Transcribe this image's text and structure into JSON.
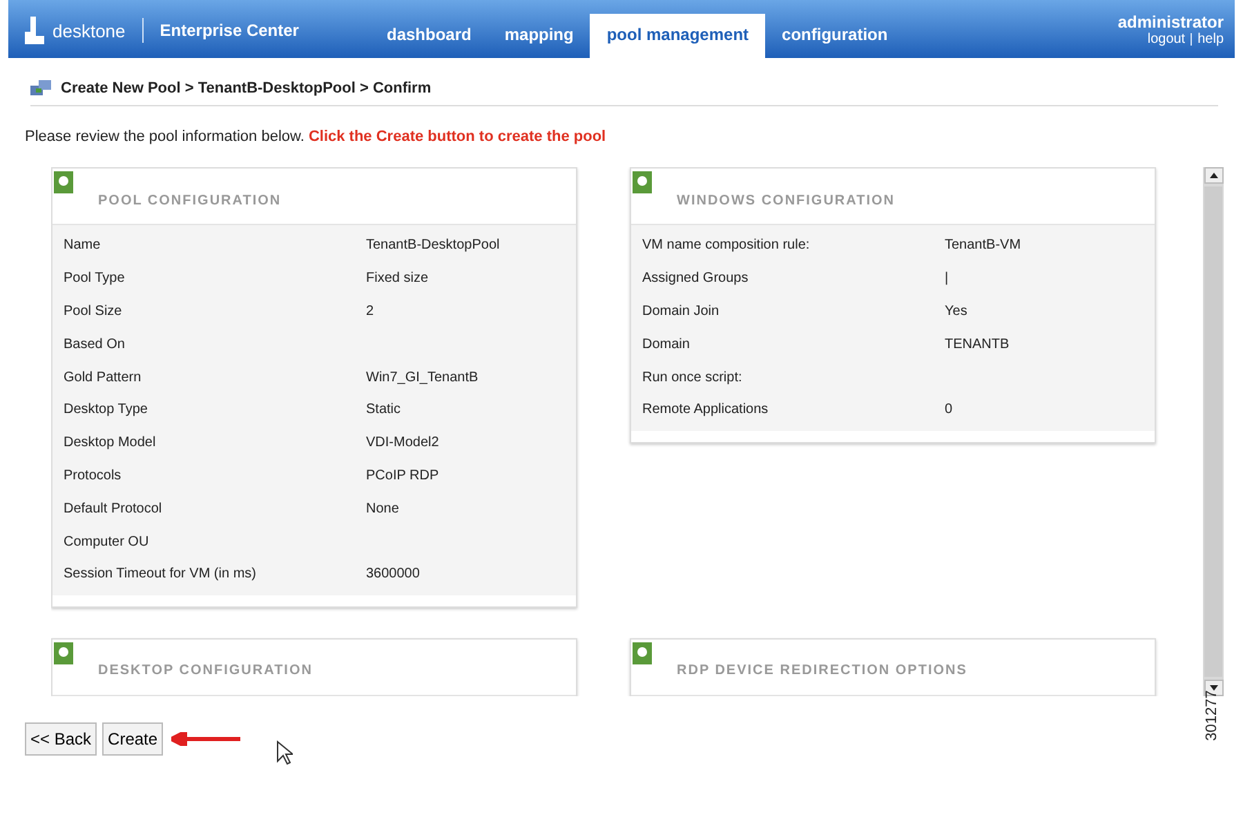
{
  "header": {
    "brand": "desktone",
    "product": "Enterprise Center",
    "tabs": [
      {
        "label": "dashboard",
        "selected": false
      },
      {
        "label": "mapping",
        "selected": false
      },
      {
        "label": "pool management",
        "selected": true
      },
      {
        "label": "configuration",
        "selected": false
      }
    ],
    "user": "administrator",
    "links": [
      "logout",
      "help"
    ]
  },
  "breadcrumb": "Create New Pool > TenantB-DesktopPool > Confirm",
  "intro": {
    "text": "Please review the pool information below.",
    "highlight": "Click the Create button to create the pool"
  },
  "panels": [
    {
      "title": "POOL CONFIGURATION",
      "rows": [
        {
          "label": "Name",
          "value": "TenantB-DesktopPool"
        },
        {
          "label": "Pool Type",
          "value": "Fixed size"
        },
        {
          "label": "Pool Size",
          "value": "2"
        },
        {
          "label": "Based On",
          "value": ""
        },
        {
          "label": "Gold Pattern",
          "value": "Win7_GI_TenantB"
        },
        {
          "label": "Desktop Type",
          "value": "Static"
        },
        {
          "label": "Desktop Model",
          "value": "VDI-Model2"
        },
        {
          "label": "Protocols",
          "value": "PCoIP RDP"
        },
        {
          "label": "Default Protocol",
          "value": "None"
        },
        {
          "label": "Computer OU",
          "value": ""
        },
        {
          "label": "Session Timeout for VM (in ms)",
          "value": "3600000"
        }
      ]
    },
    {
      "title": "WINDOWS CONFIGURATION",
      "rows": [
        {
          "label": "VM name composition rule:",
          "value": "TenantB-VM"
        },
        {
          "label": "Assigned Groups",
          "value": "|"
        },
        {
          "label": "Domain Join",
          "value": "Yes"
        },
        {
          "label": "Domain",
          "value": "TENANTB"
        },
        {
          "label": "Run once script:",
          "value": ""
        },
        {
          "label": "Remote Applications",
          "value": "0"
        }
      ]
    },
    {
      "title": "DESKTOP CONFIGURATION"
    },
    {
      "title": "RDP DEVICE REDIRECTION OPTIONS"
    }
  ],
  "buttons": [
    "<< Back",
    "Create"
  ],
  "figure_number": "301277"
}
